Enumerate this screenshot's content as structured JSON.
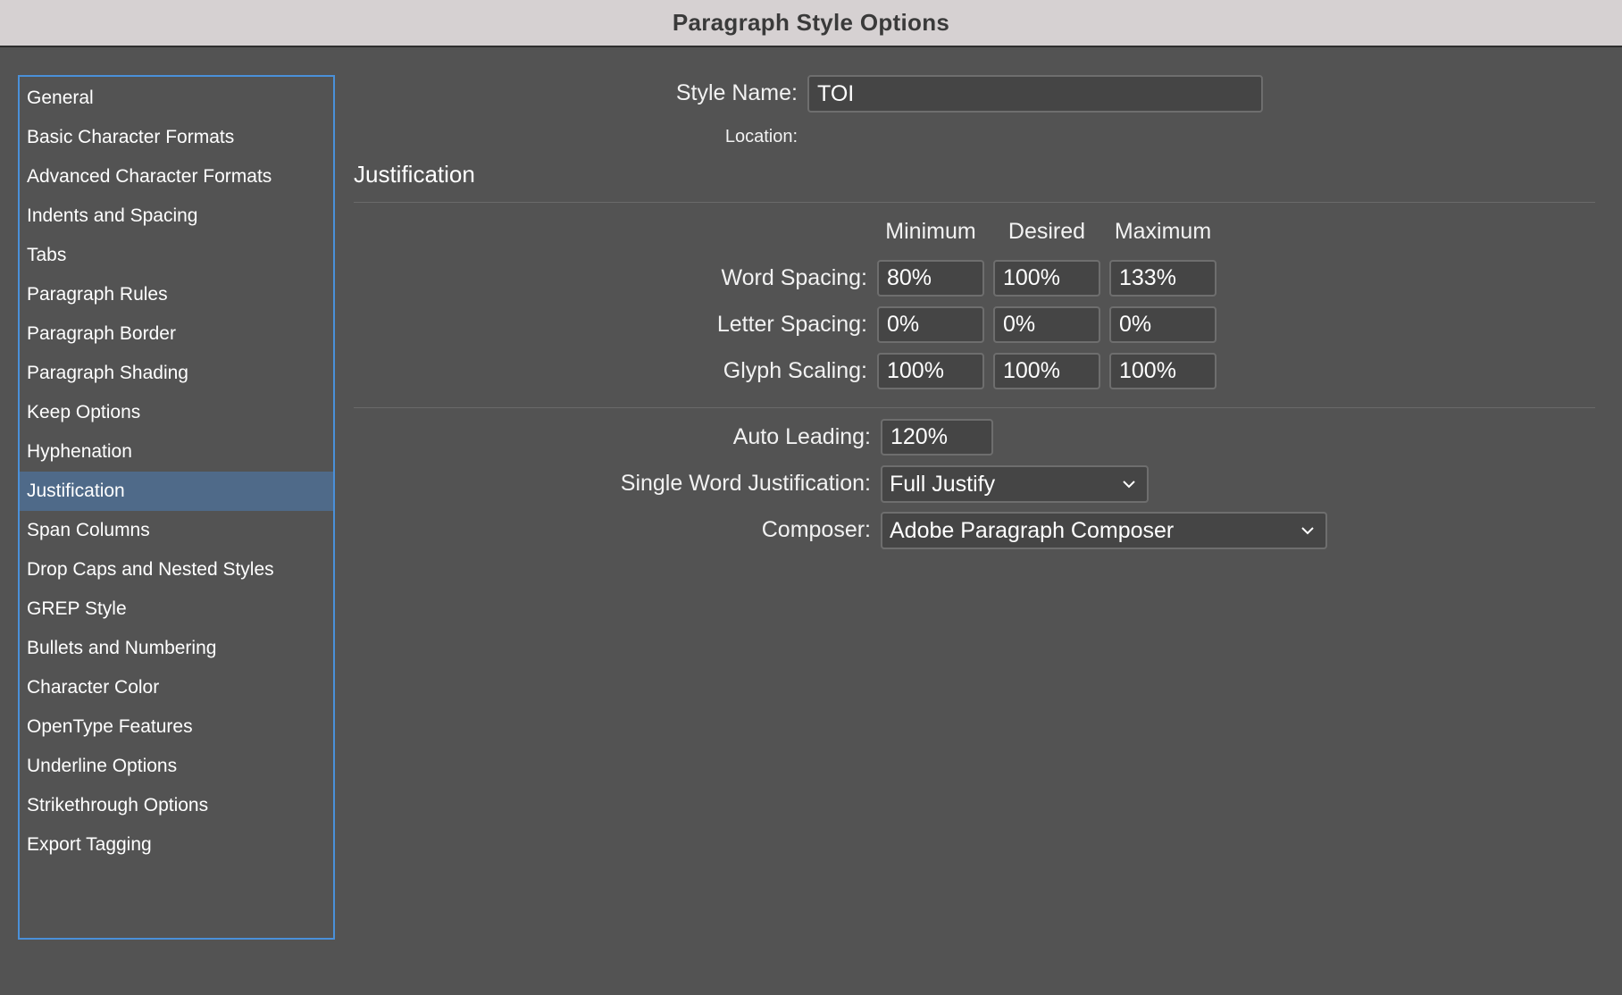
{
  "window": {
    "title": "Paragraph Style Options"
  },
  "sidebar": {
    "items": [
      {
        "label": "General"
      },
      {
        "label": "Basic Character Formats"
      },
      {
        "label": "Advanced Character Formats"
      },
      {
        "label": "Indents and Spacing"
      },
      {
        "label": "Tabs"
      },
      {
        "label": "Paragraph Rules"
      },
      {
        "label": "Paragraph Border"
      },
      {
        "label": "Paragraph Shading"
      },
      {
        "label": "Keep Options"
      },
      {
        "label": "Hyphenation"
      },
      {
        "label": "Justification"
      },
      {
        "label": "Span Columns"
      },
      {
        "label": "Drop Caps and Nested Styles"
      },
      {
        "label": "GREP Style"
      },
      {
        "label": "Bullets and Numbering"
      },
      {
        "label": "Character Color"
      },
      {
        "label": "OpenType Features"
      },
      {
        "label": "Underline Options"
      },
      {
        "label": "Strikethrough Options"
      },
      {
        "label": "Export Tagging"
      }
    ],
    "selected": "Justification"
  },
  "header": {
    "style_name_label": "Style Name:",
    "style_name_value": "TOI",
    "location_label": "Location:"
  },
  "justification": {
    "section_title": "Justification",
    "columns": [
      "Minimum",
      "Desired",
      "Maximum"
    ],
    "rows": [
      {
        "label": "Word Spacing:",
        "values": [
          "80%",
          "100%",
          "133%"
        ]
      },
      {
        "label": "Letter Spacing:",
        "values": [
          "0%",
          "0%",
          "0%"
        ]
      },
      {
        "label": "Glyph Scaling:",
        "values": [
          "100%",
          "100%",
          "100%"
        ]
      }
    ],
    "auto_leading_label": "Auto Leading:",
    "auto_leading_value": "120%",
    "single_word_label": "Single Word Justification:",
    "single_word_value": "Full Justify",
    "composer_label": "Composer:",
    "composer_value": "Adobe Paragraph Composer"
  },
  "colors": {
    "background": "#535353",
    "titlebar": "#d6d1d2",
    "selection": "#4f6a89",
    "focus_border": "#4a90d9"
  }
}
